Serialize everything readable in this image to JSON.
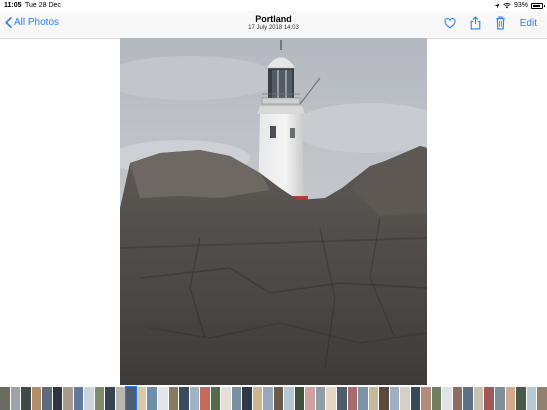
{
  "status": {
    "time": "11:05",
    "date": "Tue 28 Dec",
    "battery": "93%",
    "battery_level": 0.93
  },
  "nav": {
    "back_label": "All Photos",
    "title": "Portland",
    "subtitle": "17 July 2018  14:03",
    "edit_label": "Edit"
  },
  "icons": {
    "back": "chevron-left-icon",
    "favorite": "heart-icon",
    "share": "share-icon",
    "delete": "trash-icon",
    "wifi": "wifi-icon",
    "battery": "battery-icon",
    "location": "location-arrow-icon"
  },
  "colors": {
    "accent": "#2a7bf6"
  },
  "filmstrip": {
    "thumbnails": [
      "#6b6a5e",
      "#9aa3a8",
      "#3e4a45",
      "#b38e6a",
      "#5c6b7e",
      "#2e3340",
      "#a89a8a",
      "#5f7a9c",
      "#cdd5dc",
      "#7e8b6a",
      "#394452",
      "#b8b8b0",
      "#4d5e73",
      "#d9c9a8",
      "#6f8fa8",
      "#e2e6ea",
      "#8a7a5f",
      "#3c4b5c",
      "#9fb3c4",
      "#c46b5a",
      "#556b4f",
      "#e5e0d5",
      "#7a8f9f",
      "#2f3a48",
      "#d0b48c",
      "#98a8b8",
      "#6c5a48",
      "#b6c7d4",
      "#40523e",
      "#cfa1a1",
      "#8e9ea8",
      "#e6d7c4",
      "#4f5c6b",
      "#a86a6a",
      "#7d94a8",
      "#c7b89a",
      "#5b4a3b",
      "#9bb0c2",
      "#d6cfc5",
      "#384858",
      "#b48a7a",
      "#6f7f60",
      "#e0e4e8",
      "#8c6f62",
      "#5d7187",
      "#c9c0b0",
      "#a05858",
      "#7f8f9a",
      "#d2a98e",
      "#4a5a49",
      "#bac9d6",
      "#93816f"
    ],
    "selected_index": 12
  }
}
